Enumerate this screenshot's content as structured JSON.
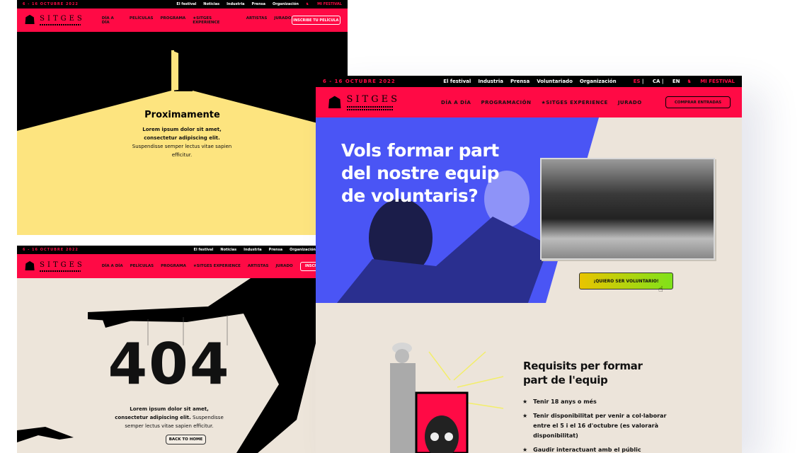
{
  "festival_dates": "6 - 16 OCTUBRE 2022",
  "brand": {
    "name": "SITGES",
    "accent": "#ff0a45",
    "blue": "#4a55f5",
    "beige": "#ece4da",
    "yellow": "#fde47f"
  },
  "coming_soon": {
    "top_links": [
      "El festival",
      "Noticias",
      "Industria",
      "Prensa",
      "Organización"
    ],
    "mi_festival": "MI FESTIVAL",
    "nav": [
      "DÍA A DÍA",
      "PELÍCULAS",
      "PROGRAMA",
      "★SITGES EXPERIENCE",
      "ARTISTAS",
      "JURADO"
    ],
    "cta": "INSCRIBE TU PELÍCULA",
    "title": "Proximamente",
    "text_bold": "Lorem ipsum dolor sit amet, consectetur adipiscing elit.",
    "text_rest": "Suspendisse semper lectus vitae sapien efficitur."
  },
  "not_found": {
    "top_links": [
      "El festival",
      "Noticias",
      "Industria",
      "Prensa",
      "Organización"
    ],
    "nav": [
      "DÍA A DÍA",
      "PELÍCULAS",
      "PROGRAMA",
      "★SITGES EXPERIENCE",
      "ARTISTAS",
      "JURADO"
    ],
    "cta": "INSCRIBE",
    "code": "404",
    "text_bold": "Lorem ipsum dolor sit amet, consectetur adipiscing elit.",
    "text_rest": "Suspendisse semper lectus vitae sapien efficitur.",
    "back_button": "BACK TO HOME"
  },
  "volunteer": {
    "top_links": [
      "El festival",
      "Industria",
      "Prensa",
      "Voluntariado",
      "Organización"
    ],
    "languages": {
      "es": "ES",
      "ca": "CA",
      "en": "EN"
    },
    "mi_festival": "MI FESTIVAL",
    "nav": [
      "DÍA A DÍA",
      "PROGRAMACIÓN",
      "★SITGES EXPERIENCE",
      "JURADO"
    ],
    "cta": "COMPRAR ENTRADAS",
    "hero_title": "Vols formar part del nostre equip de voluntaris?",
    "hero_button": "¡QUIERO SER VOLUNTARIO!",
    "req_title": "Requisits per formar part de l'equip",
    "requirements": [
      "Tenir 18 anys o més",
      "Tenir disponibilitat per venir a col·laborar entre el 5 i el 16 d'octubre  (es valorarà disponibilitat)",
      "Gaudir interactuant amb el públic"
    ]
  }
}
